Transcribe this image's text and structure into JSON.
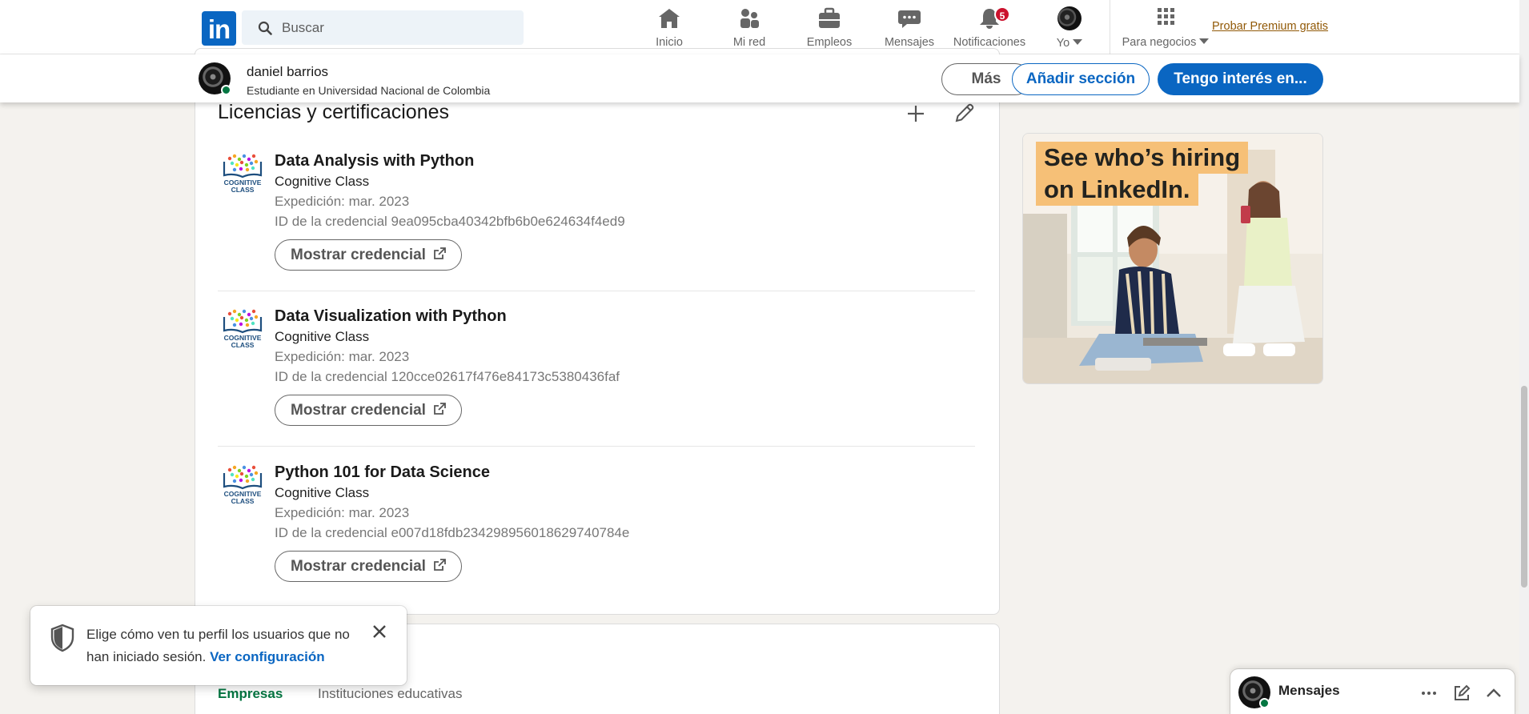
{
  "nav": {
    "logo_text": "in",
    "search_placeholder": "Buscar",
    "items": [
      {
        "label": "Inicio",
        "icon": "home-icon"
      },
      {
        "label": "Mi red",
        "icon": "people-icon"
      },
      {
        "label": "Empleos",
        "icon": "briefcase-icon"
      },
      {
        "label": "Mensajes",
        "icon": "chat-icon"
      },
      {
        "label": "Notificaciones",
        "icon": "bell-icon",
        "badge": "5"
      },
      {
        "label": "Yo",
        "icon": "avatar"
      },
      {
        "label": "Para negocios",
        "icon": "grid-icon"
      }
    ],
    "premium_link": "Probar Premium gratis"
  },
  "profile_bar": {
    "name": "daniel barrios",
    "headline": "Estudiante en Universidad Nacional de Colombia",
    "more_label": "Más",
    "add_section_label": "Añadir sección",
    "open_to_label": "Tengo interés en..."
  },
  "licenses": {
    "section_title": "Licencias y certificaciones",
    "items": [
      {
        "title": "Data Analysis with Python",
        "org": "Cognitive Class",
        "issued": "Expedición: mar. 2023",
        "credential_id": "ID de la credencial 9ea095cba40342bfb6b0e624634f4ed9",
        "button": "Mostrar credencial"
      },
      {
        "title": "Data Visualization with Python",
        "org": "Cognitive Class",
        "issued": "Expedición: mar. 2023",
        "credential_id": "ID de la credencial 120cce02617f476e84173c5380436faf",
        "button": "Mostrar credencial"
      },
      {
        "title": "Python 101 for Data Science",
        "org": "Cognitive Class",
        "issued": "Expedición: mar. 2023",
        "credential_id": "ID de la credencial e007d18fdb2342989560186297407 84e",
        "button": "Mostrar credencial"
      }
    ],
    "logo_text_line1": "COGNITIVE",
    "logo_text_line2": "CLASS"
  },
  "interests": {
    "tabs": [
      "Empresas",
      "Instituciones educativas"
    ]
  },
  "ad": {
    "line1": "See who’s hiring",
    "line2": "on LinkedIn."
  },
  "toast": {
    "text": "Elige cómo ven tu perfil los usuarios que no han iniciado sesión.",
    "link": "Ver configuración"
  },
  "messaging": {
    "title": "Mensajes"
  },
  "colors": {
    "brand": "#0a66c2",
    "badge": "#cb112d",
    "premium": "#915907",
    "online": "#057642",
    "active_tab": "#057642"
  }
}
